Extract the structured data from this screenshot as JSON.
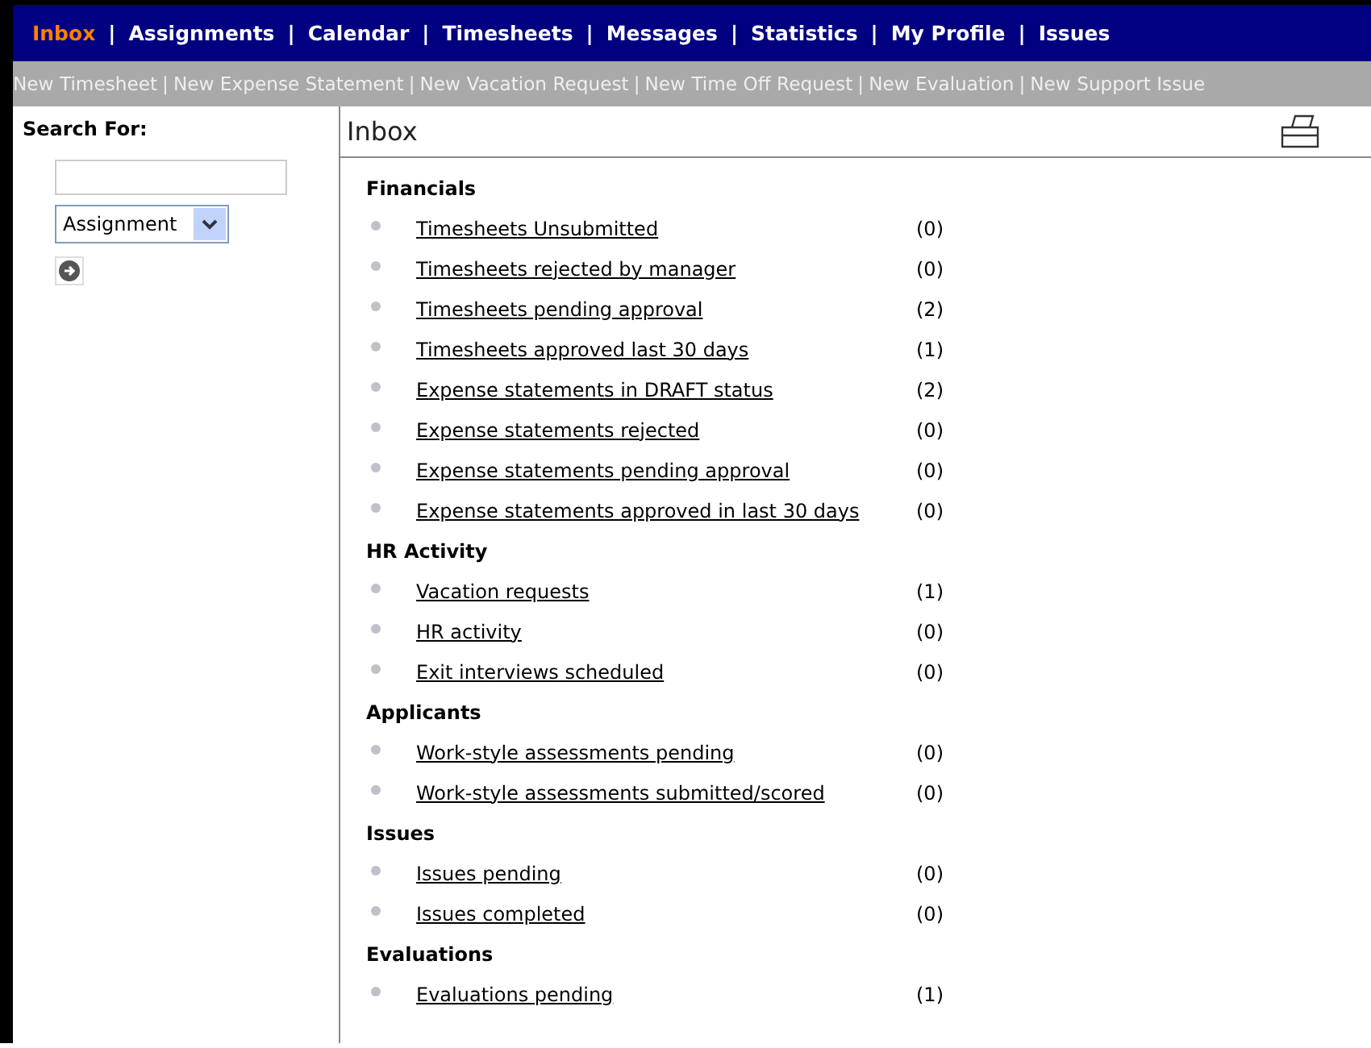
{
  "nav": [
    {
      "label": "Inbox",
      "selected": true
    },
    {
      "label": "Assignments",
      "selected": false
    },
    {
      "label": "Calendar",
      "selected": false
    },
    {
      "label": "Timesheets",
      "selected": false
    },
    {
      "label": "Messages",
      "selected": false
    },
    {
      "label": "Statistics",
      "selected": false
    },
    {
      "label": "My Profile",
      "selected": false
    },
    {
      "label": "Issues",
      "selected": false
    }
  ],
  "separator": "|",
  "subnav": [
    "New Timesheet",
    "New Expense Statement",
    "New Vacation Request",
    "New Time Off Request",
    "New Evaluation",
    "New Support Issue"
  ],
  "sidebar": {
    "title": "Search For:",
    "select_value": "Assignment"
  },
  "page_title": "Inbox",
  "sections": [
    {
      "title": "Financials",
      "items": [
        {
          "label": "Timesheets Unsubmitted",
          "count": "(0)"
        },
        {
          "label": "Timesheets rejected by manager",
          "count": "(0)"
        },
        {
          "label": "Timesheets pending approval",
          "count": "(2)"
        },
        {
          "label": "Timesheets approved last 30 days",
          "count": "(1)"
        },
        {
          "label": "Expense statements in DRAFT status",
          "count": "(2)"
        },
        {
          "label": "Expense statements rejected",
          "count": "(0)"
        },
        {
          "label": "Expense statements pending approval",
          "count": "(0)"
        },
        {
          "label": "Expense statements approved in last 30 days",
          "count": "(0)"
        }
      ]
    },
    {
      "title": "HR Activity",
      "items": [
        {
          "label": "Vacation requests",
          "count": "(1)"
        },
        {
          "label": "HR activity",
          "count": "(0)"
        },
        {
          "label": "Exit interviews scheduled",
          "count": "(0)"
        }
      ]
    },
    {
      "title": "Applicants",
      "items": [
        {
          "label": "Work-style assessments pending",
          "count": "(0)"
        },
        {
          "label": "Work-style assessments submitted/scored",
          "count": "(0)"
        }
      ]
    },
    {
      "title": "Issues",
      "items": [
        {
          "label": "Issues pending",
          "count": "(0)"
        },
        {
          "label": "Issues completed",
          "count": "(0)"
        }
      ]
    },
    {
      "title": "Evaluations",
      "items": [
        {
          "label": "Evaluations pending",
          "count": "(1)"
        }
      ]
    }
  ]
}
